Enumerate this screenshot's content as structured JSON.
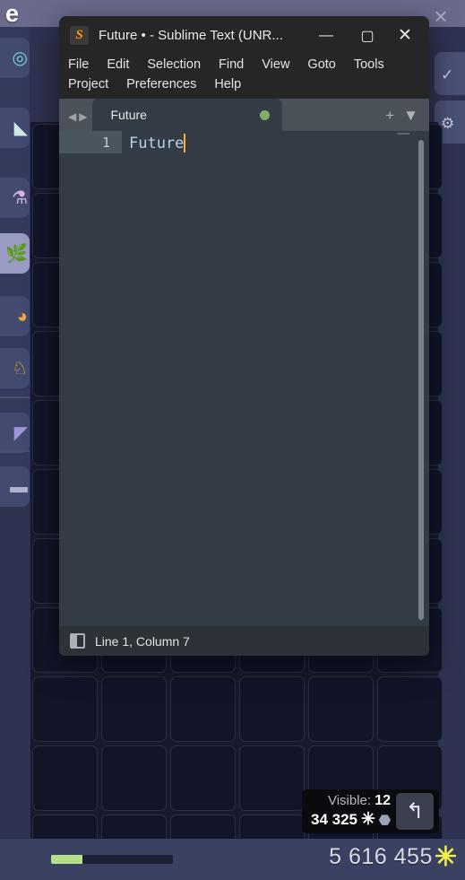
{
  "game": {
    "header_title": "e",
    "close_icon": "×",
    "inventory": [
      {
        "name": "ring-item",
        "glyph": "◎",
        "color": "#6fd8cf",
        "selected": false
      },
      {
        "name": "blade-item",
        "glyph": "◣",
        "color": "#cfe8e4",
        "selected": false
      },
      {
        "name": "potion-item",
        "glyph": "⚗",
        "color": "#d6b3e8",
        "selected": false
      },
      {
        "name": "leaf-item",
        "glyph": "🌿",
        "color": "#8fd15a",
        "selected": true
      },
      {
        "name": "orange-item",
        "glyph": "◕",
        "color": "#f0a63c",
        "selected": false
      },
      {
        "name": "gold-item",
        "glyph": "♘",
        "color": "#e8a81e",
        "selected": false
      },
      {
        "name": "purple-item",
        "glyph": "◤",
        "color": "#9f95d9",
        "selected": false
      },
      {
        "name": "grey-item",
        "glyph": "▬",
        "color": "#b0b3cc",
        "selected": false
      }
    ],
    "hud": {
      "visible_label": "Visible:",
      "visible_count": "12",
      "resource_amount": "34 325",
      "resource_icon": "snowflake-icon",
      "weight_icon": "weight-icon",
      "undo_icon": "↰"
    },
    "bottom": {
      "xp_percent": 26,
      "currency_value": "5 616 455",
      "currency_icon": "snowflake-icon"
    }
  },
  "sublime": {
    "titlebar": {
      "logo": "S",
      "title": "Future • - Sublime Text (UNR...",
      "minimize": "—",
      "maximize": "▢",
      "close": "✕"
    },
    "menu": [
      "File",
      "Edit",
      "Selection",
      "Find",
      "View",
      "Goto",
      "Tools",
      "Project",
      "Preferences",
      "Help"
    ],
    "tabbar": {
      "nav_back": "◀",
      "nav_forward": "▶",
      "tab_label": "Future",
      "modified_dot": true,
      "new_tab": "+",
      "tab_menu": "▼"
    },
    "editor": {
      "line_number": "1",
      "line_text": "Future"
    },
    "status": {
      "sidebar_toggle_icon": "panel-icon",
      "position": "Line 1, Column 7"
    }
  }
}
